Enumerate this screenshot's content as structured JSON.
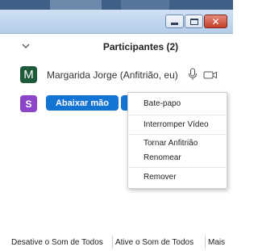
{
  "window": {
    "minimize_glyph": "minimize-icon",
    "maximize_glyph": "maximize-icon",
    "close_label": "✕"
  },
  "panel": {
    "title": "Participantes (2)",
    "collapse_icon": "chevron-down-icon"
  },
  "participants": [
    {
      "initial": "M",
      "name": "Margarida Jorge (Anfitrião, eu)",
      "avatar_color": "#1c5a3a"
    },
    {
      "initial": "S",
      "avatar_color": "#8b46c8",
      "lower_hand_label": "Abaixar mão"
    }
  ],
  "context_menu": {
    "items": [
      "Bate-papo",
      "Interromper Vídeo",
      "Tornar Anfitrião",
      "Renomear",
      "Remover"
    ]
  },
  "bottom_toolbar": {
    "mute_all": "Desative o Som de Todos",
    "unmute_all": "Ative o Som de Todos",
    "more": "Mais"
  },
  "colors": {
    "accent_button": "#1474d4",
    "title_bar": "#c3d7ee"
  }
}
